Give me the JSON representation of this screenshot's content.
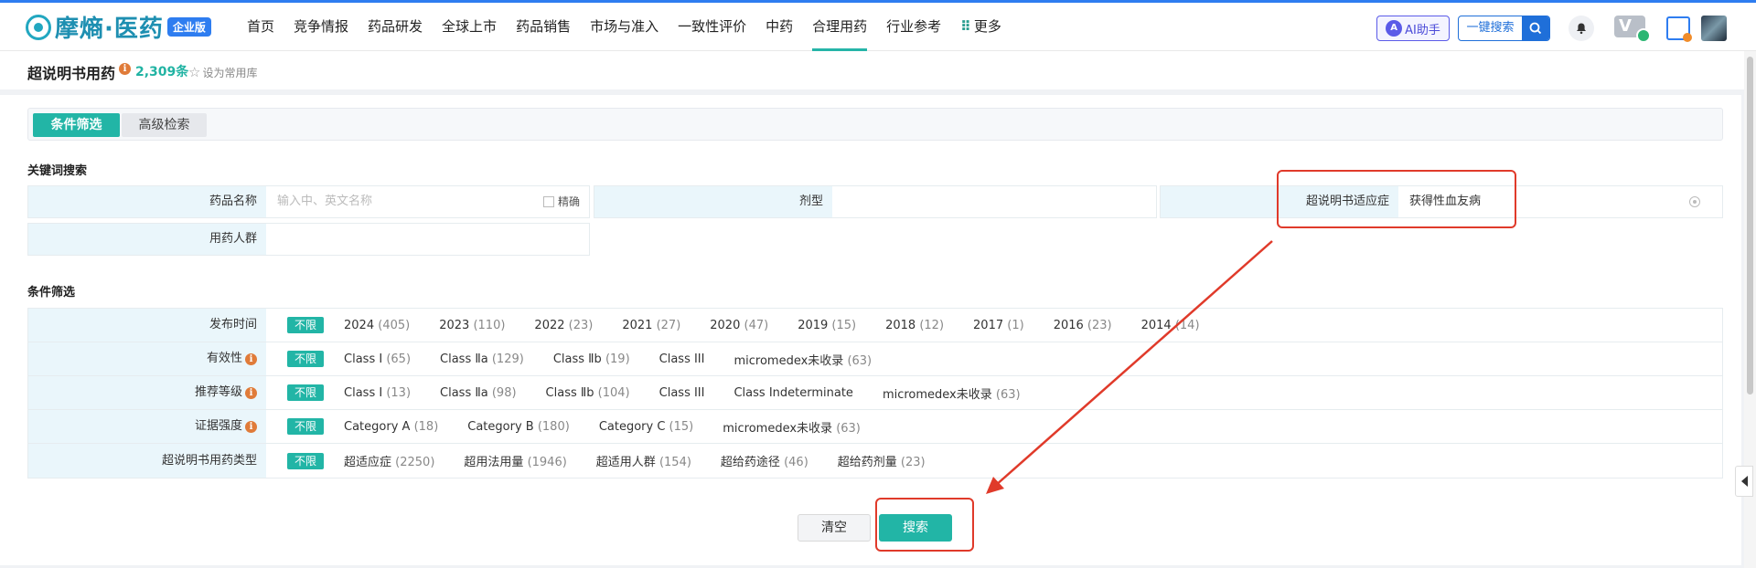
{
  "brand": {
    "name": "摩熵·医药",
    "edition": "企业版"
  },
  "nav": {
    "items": [
      {
        "label": "首页",
        "active": false
      },
      {
        "label": "竞争情报",
        "active": false
      },
      {
        "label": "药品研发",
        "active": false
      },
      {
        "label": "全球上市",
        "active": false
      },
      {
        "label": "药品销售",
        "active": false
      },
      {
        "label": "市场与准入",
        "active": false
      },
      {
        "label": "一致性评价",
        "active": false
      },
      {
        "label": "中药",
        "active": false
      },
      {
        "label": "合理用药",
        "active": true
      },
      {
        "label": "行业参考",
        "active": false
      }
    ],
    "more_label": "更多"
  },
  "header_actions": {
    "ai_label": "AI助手",
    "search_label": "一键搜索",
    "vip_label": "V"
  },
  "page": {
    "title": "超说明书用药",
    "count": "2,309条",
    "favorite_label": "设为常用库"
  },
  "tabs": [
    {
      "label": "条件筛选",
      "active": true
    },
    {
      "label": "高级检索",
      "active": false
    }
  ],
  "keyword_section": {
    "title": "关键词搜索",
    "fields": {
      "drug_name": {
        "label": "药品名称",
        "placeholder": "输入中、英文名称",
        "exact_label": "精确"
      },
      "dosage_form": {
        "label": "剂型",
        "value": ""
      },
      "indication": {
        "label": "超说明书适应症",
        "value": "获得性血友病"
      },
      "population": {
        "label": "用药人群",
        "value": ""
      }
    }
  },
  "filter_section": {
    "title": "条件筛选",
    "unlimited_label": "不限",
    "rows": [
      {
        "label": "发布时间",
        "info": false,
        "options": [
          {
            "label": "2024",
            "count": "(405)"
          },
          {
            "label": "2023",
            "count": "(110)"
          },
          {
            "label": "2022",
            "count": "(23)"
          },
          {
            "label": "2021",
            "count": "(27)"
          },
          {
            "label": "2020",
            "count": "(47)"
          },
          {
            "label": "2019",
            "count": "(15)"
          },
          {
            "label": "2018",
            "count": "(12)"
          },
          {
            "label": "2017",
            "count": "(1)"
          },
          {
            "label": "2016",
            "count": "(23)"
          },
          {
            "label": "2014",
            "count": "(14)"
          }
        ]
      },
      {
        "label": "有效性",
        "info": true,
        "options": [
          {
            "label": "Class Ⅰ",
            "count": "(65)"
          },
          {
            "label": "Class Ⅱa",
            "count": "(129)"
          },
          {
            "label": "Class Ⅱb",
            "count": "(19)"
          },
          {
            "label": "Class III",
            "count": ""
          },
          {
            "label": "micromedex未收录",
            "count": "(63)"
          }
        ]
      },
      {
        "label": "推荐等级",
        "info": true,
        "options": [
          {
            "label": "Class Ⅰ",
            "count": "(13)"
          },
          {
            "label": "Class Ⅱa",
            "count": "(98)"
          },
          {
            "label": "Class Ⅱb",
            "count": "(104)"
          },
          {
            "label": "Class III",
            "count": ""
          },
          {
            "label": "Class Indeterminate",
            "count": ""
          },
          {
            "label": "micromedex未收录",
            "count": "(63)"
          }
        ]
      },
      {
        "label": "证据强度",
        "info": true,
        "options": [
          {
            "label": "Category A",
            "count": "(18)"
          },
          {
            "label": "Category B",
            "count": "(180)"
          },
          {
            "label": "Category C",
            "count": "(15)"
          },
          {
            "label": "micromedex未收录",
            "count": "(63)"
          }
        ]
      },
      {
        "label": "超说明书用药类型",
        "info": false,
        "options": [
          {
            "label": "超适应症",
            "count": "(2250)"
          },
          {
            "label": "超用法用量",
            "count": "(1946)"
          },
          {
            "label": "超适用人群",
            "count": "(154)"
          },
          {
            "label": "超给药途径",
            "count": "(46)"
          },
          {
            "label": "超给药剂量",
            "count": "(23)"
          }
        ]
      }
    ]
  },
  "actions": {
    "clear_label": "清空",
    "search_label": "搜索"
  },
  "colors": {
    "accent": "#22b5a6",
    "nav_border": "#2e7df0",
    "annotation": "#e03a2a",
    "label_bg": "#eaf6fb"
  }
}
